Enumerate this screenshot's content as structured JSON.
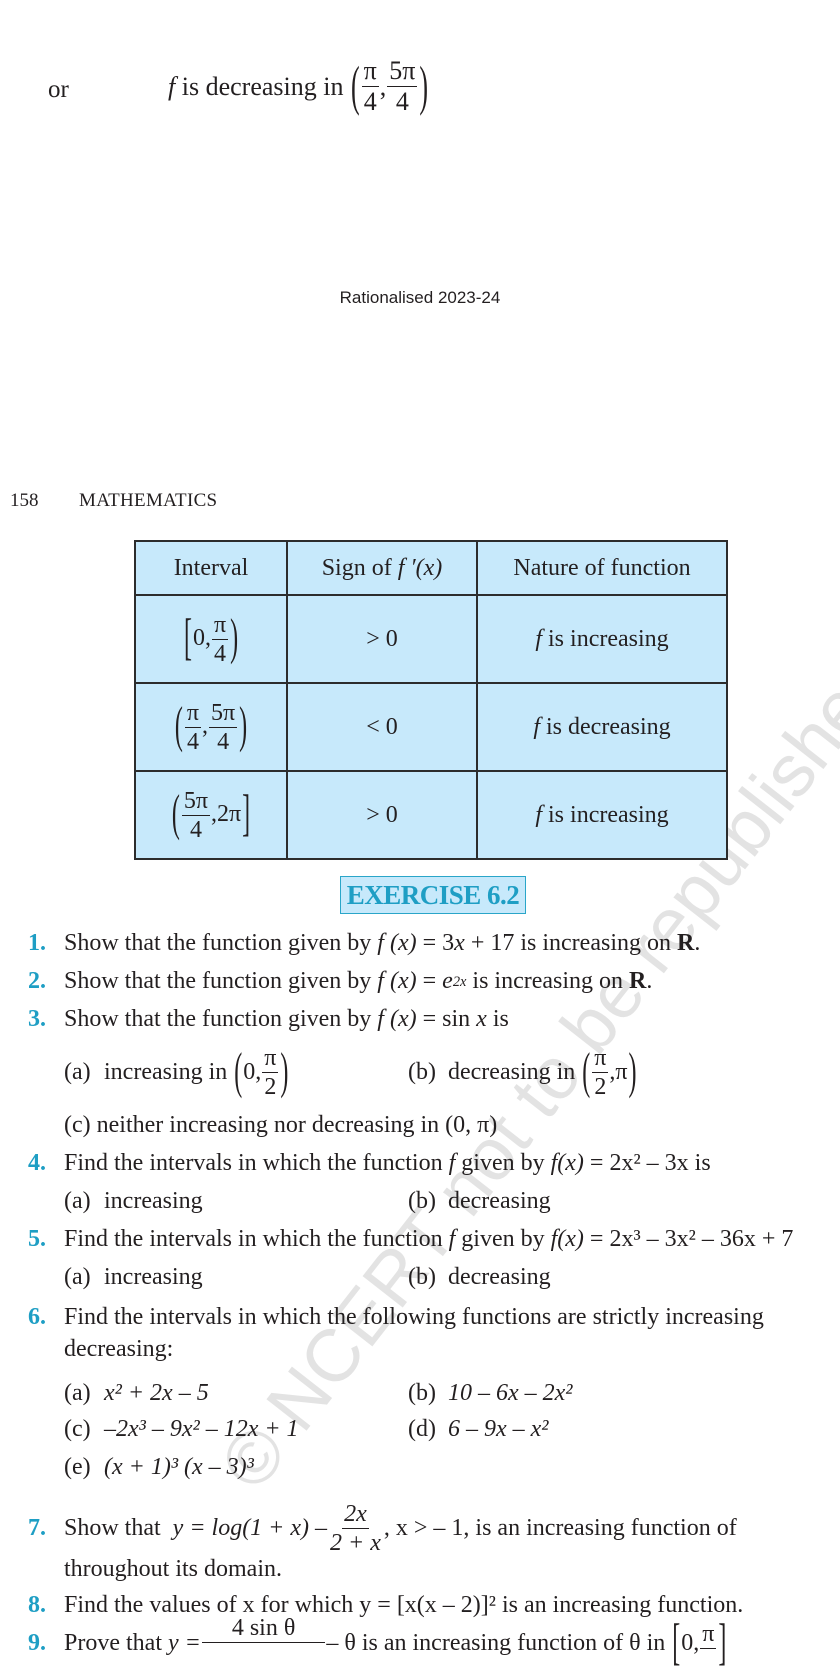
{
  "page": {
    "clipped_top": "(π/4, 5π/4)",
    "or_label": "or",
    "decreasing_statement": {
      "f": "f",
      "text": "is decreasing in",
      "interval_open": "(",
      "a_num": "π",
      "a_den": "4",
      "sep": ",",
      "b_num": "5π",
      "b_den": "4",
      "interval_close": ")"
    },
    "rationalised": "Rationalised 2023-24",
    "page_number": "158",
    "running_head": "MATHEMATICS"
  },
  "table": {
    "headers": [
      "Interval",
      "Sign of",
      "Nature of function"
    ],
    "header_fprime": "f ′(x)",
    "rows": [
      {
        "interval": {
          "open": "[",
          "left": "0,",
          "num": "π",
          "den": "4",
          "right": "",
          "close": ")"
        },
        "sign": "> 0",
        "nature_f": "f",
        "nature": "is increasing"
      },
      {
        "interval": {
          "open": "(",
          "left": "",
          "num": "π",
          "den": "4",
          "mid": ",",
          "num2": "5π",
          "den2": "4",
          "close": ")"
        },
        "sign": "< 0",
        "nature_f": "f",
        "nature": "is decreasing"
      },
      {
        "interval": {
          "open": "(",
          "num": "5π",
          "den": "4",
          "right": ",2π",
          "close": "]"
        },
        "sign": "> 0",
        "nature_f": "f",
        "nature": "is increasing"
      }
    ]
  },
  "exercise": {
    "title": "EXERCISE 6.2",
    "questions": [
      {
        "n": "1.",
        "pre": "Show that the function given by",
        "fx": "f (x)",
        "eq": "= 3",
        "x": "x",
        "post": "+ 17 is increasing on",
        "R": "R",
        "end": "."
      },
      {
        "n": "2.",
        "pre": "Show that the function given by",
        "fx": "f (x)",
        "eq": "=",
        "e": "e",
        "exp": "2x",
        "post": "is increasing on",
        "R": "R",
        "end": "."
      },
      {
        "n": "3.",
        "pre": "Show that the function given by",
        "fx": "f (x)",
        "eq": "= sin",
        "x": "x",
        "post": "is",
        "parts": [
          {
            "label": "(a)",
            "text": "increasing in",
            "open": "(",
            "left": "0,",
            "num": "π",
            "den": "2",
            "close": ")"
          },
          {
            "label": "(b)",
            "text": "decreasing in",
            "open": "(",
            "num": "π",
            "den": "2",
            "right": ",π",
            "close": ")"
          },
          {
            "label": "(c)",
            "text": "neither increasing nor decreasing in (0, π)"
          }
        ]
      },
      {
        "n": "4.",
        "pre": "Find the intervals in which the function",
        "f": "f",
        "mid": "given by",
        "fx": "f(x)",
        "expr": "= 2x² – 3x is",
        "parts": [
          {
            "label": "(a)",
            "text": "increasing"
          },
          {
            "label": "(b)",
            "text": "decreasing"
          }
        ]
      },
      {
        "n": "5.",
        "pre": "Find the intervals in which the function",
        "f": "f",
        "mid": "given by",
        "fx": "f(x)",
        "expr": "= 2x³ – 3x² – 36x + 7",
        "parts": [
          {
            "label": "(a)",
            "text": "increasing"
          },
          {
            "label": "(b)",
            "text": "decreasing"
          }
        ]
      },
      {
        "n": "6.",
        "line1": "Find the intervals in which the following functions are strictly increasing",
        "line2": "decreasing:",
        "parts": [
          {
            "label": "(a)",
            "text": "x² + 2x – 5"
          },
          {
            "label": "(b)",
            "text": "10 – 6x – 2x²"
          },
          {
            "label": "(c)",
            "text": "–2x³ – 9x² – 12x + 1"
          },
          {
            "label": "(d)",
            "text": "6 – 9x – x²"
          },
          {
            "label": "(e)",
            "text": "(x + 1)³ (x – 3)³"
          }
        ]
      },
      {
        "n": "7.",
        "pre": "Show that",
        "y_eq": "y = log(1 + x) –",
        "num": "2x",
        "den": "2 + x",
        "post": ", x > – 1, is  an increasing function of",
        "line2": "throughout its domain."
      },
      {
        "n": "8.",
        "text": "Find the values of x for which y = [x(x – 2)]² is an increasing function."
      },
      {
        "n": "9.",
        "pre": "Prove that",
        "y_eq": "y =",
        "num": "4 sin θ",
        "post": "– θ  is an increasing function of θ  in",
        "open": "[",
        "left": "0,",
        "frac_num": "π",
        "close": "]"
      }
    ]
  },
  "watermark": {
    "text": "© NCERT not to be republished"
  },
  "colors": {
    "accent": "#1e9ec4",
    "table_bg": "#c7e9fb",
    "text": "#231f20",
    "watermark": "#e3e3e3"
  }
}
